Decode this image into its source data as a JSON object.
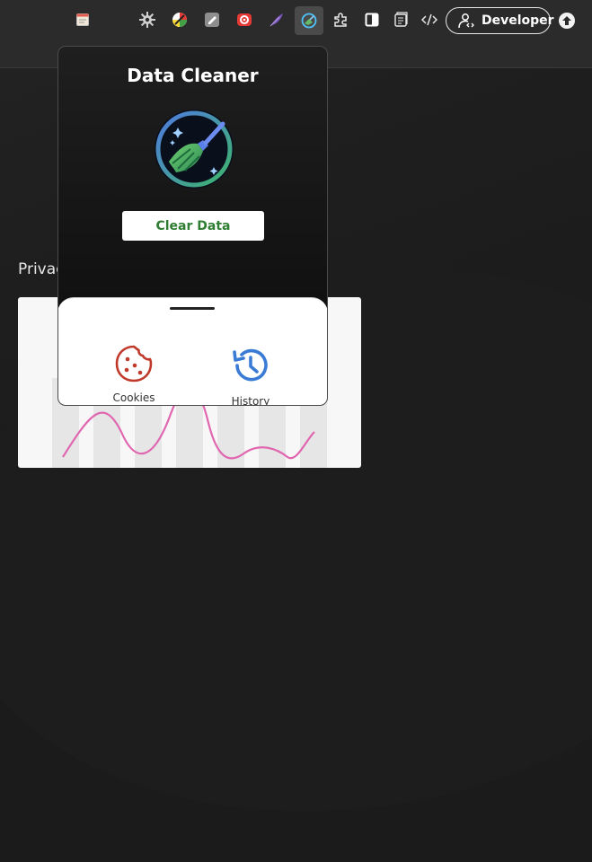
{
  "toolbar": {
    "icons": [
      {
        "name": "extension-notes-icon",
        "active": false
      },
      {
        "name": "extension-gear-icon",
        "active": false
      },
      {
        "name": "extension-color-icon",
        "active": false
      },
      {
        "name": "extension-edit-icon",
        "active": false
      },
      {
        "name": "extension-record-icon",
        "active": false
      },
      {
        "name": "extension-feather-icon",
        "active": false
      },
      {
        "name": "extension-data-cleaner-icon",
        "active": true
      },
      {
        "name": "extensions-puzzle-icon",
        "active": false
      },
      {
        "name": "sidebar-toggle-icon",
        "active": false
      },
      {
        "name": "reading-list-icon",
        "active": false
      },
      {
        "name": "code-icon",
        "active": false
      }
    ],
    "developer_label": "Developer"
  },
  "page": {
    "section_label": "Privac"
  },
  "popup": {
    "title": "Data Cleaner",
    "clear_button": "Clear Data",
    "options": [
      {
        "label": "Cookies",
        "icon": "cookie-icon",
        "color": "#c0392b"
      },
      {
        "label": "History",
        "icon": "history-icon",
        "color": "#3a7bd5"
      }
    ]
  },
  "colors": {
    "accent_green": "#2e7d32",
    "chart_line": "#e066b0"
  }
}
